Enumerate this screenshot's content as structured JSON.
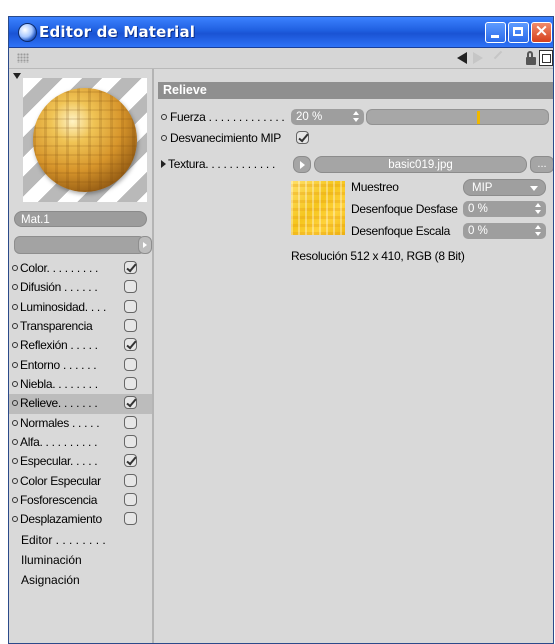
{
  "window": {
    "title": "Editor de Material",
    "minimize_icon": "minimize-icon",
    "maximize_icon": "maximize-icon",
    "close_icon": "close-icon"
  },
  "toolbar": {
    "icons": [
      "grip-icon",
      "back-arrow-icon",
      "forward-arrow-icon",
      "up-arrow-icon",
      "lock-icon",
      "new-window-icon"
    ]
  },
  "material": {
    "name": "Mat.1",
    "preview_icon": "material-sphere-preview"
  },
  "channels": [
    {
      "label": "Color. . . . . . . . .",
      "checked": true
    },
    {
      "label": "Difusión . . . . . .",
      "checked": false
    },
    {
      "label": "Luminosidad. . . .",
      "checked": false
    },
    {
      "label": "Transparencia",
      "checked": false
    },
    {
      "label": "Reflexión . . . . .",
      "checked": true
    },
    {
      "label": "Entorno . . . . . .",
      "checked": false
    },
    {
      "label": "Niebla. . . . . . . .",
      "checked": false
    },
    {
      "label": "Relieve. . . . . . .",
      "checked": true,
      "selected": true
    },
    {
      "label": "Normales . . . . .",
      "checked": false
    },
    {
      "label": "Alfa. . . . . . . . . .",
      "checked": false
    },
    {
      "label": "Especular. . . . .",
      "checked": true
    },
    {
      "label": "Color Especular",
      "checked": false
    },
    {
      "label": "Fosforescencia",
      "checked": false
    },
    {
      "label": "Desplazamiento",
      "checked": false
    }
  ],
  "extra_nav": [
    "Editor . . . . . . . .",
    "Iluminación",
    "Asignación"
  ],
  "relieve": {
    "header": "Relieve",
    "fuerza_label": "Fuerza . . . . . . . . . . . . .",
    "fuerza_value": "20 %",
    "fuerza_fraction": 0.2,
    "mip_label": "Desvanecimiento MIP",
    "mip_checked": true,
    "textura_label": "Textura. . . . . . . . . . . .",
    "texture_file": "basic019.jpg",
    "more_button": "...",
    "muestreo_label": "Muestreo",
    "muestreo_value": "MIP",
    "desenfoque_desfase_label": "Desenfoque Desfase",
    "desenfoque_desfase_value": "0 %",
    "desenfoque_escala_label": "Desenfoque Escala",
    "desenfoque_escala_value": "0 %",
    "resolution": "Resolución 512 x 410, RGB (8 Bit)"
  }
}
